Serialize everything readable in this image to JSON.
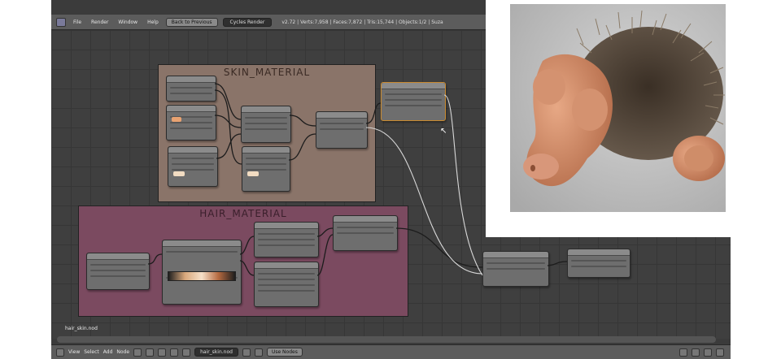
{
  "header": {
    "editor_icon": "node-editor-icon",
    "menus": [
      "File",
      "Render",
      "Window",
      "Help"
    ],
    "back_button": "Back to Previous",
    "engine": "Cycles Render",
    "stats": "v2.72 | Verts:7,958 | Faces:7,872 | Tris:15,744 | Objects:1/2 | Suza"
  },
  "frames": {
    "skin": "SKIN_MATERIAL",
    "hair": "HAIR_MATERIAL"
  },
  "frame_colors": {
    "skin": "#8a7469",
    "hair": "#7b4a60"
  },
  "editor": {
    "material_name": "hair_skin.nod"
  },
  "footer": {
    "menus": [
      "View",
      "Select",
      "Add",
      "Node"
    ],
    "material_field": "hair_skin.nod",
    "use_nodes": "Use Nodes"
  }
}
